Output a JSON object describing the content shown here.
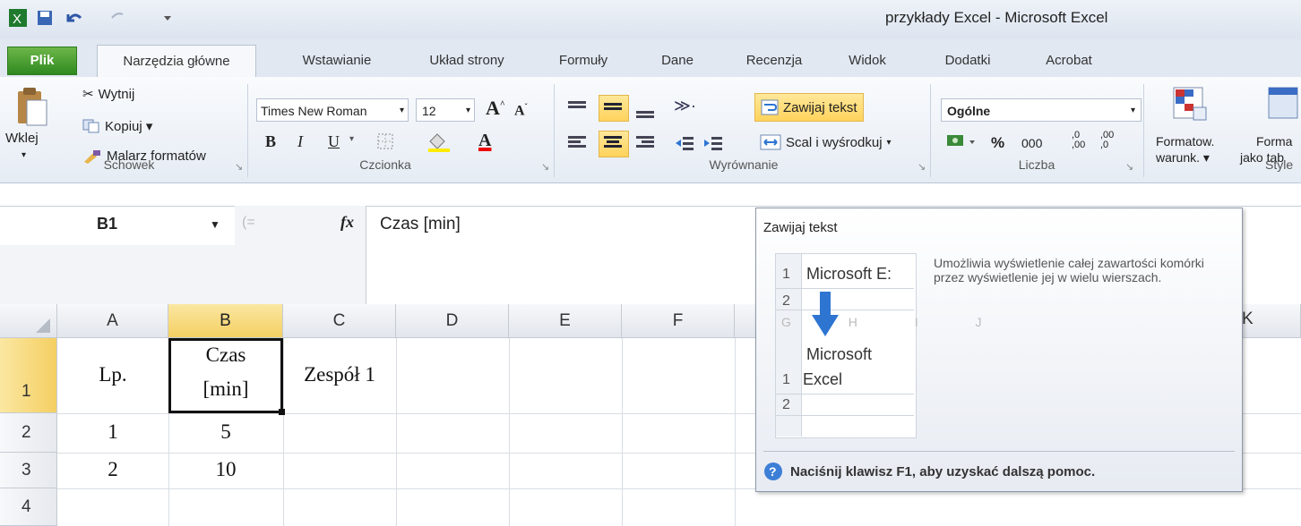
{
  "window": {
    "title": "przykłady Excel - Microsoft Excel"
  },
  "tabs": [
    "Plik",
    "Narzędzia główne",
    "Wstawianie",
    "Układ strony",
    "Formuły",
    "Dane",
    "Recenzja",
    "Widok",
    "Dodatki",
    "Acrobat"
  ],
  "clipboard": {
    "paste": "Wklej",
    "cut": "Wytnij",
    "copy": "Kopiuj ▾",
    "painter": "Malarz formatów",
    "group": "Schowek"
  },
  "font": {
    "name": "Times New Roman",
    "size": "12",
    "group": "Czcionka",
    "bold": "B",
    "italic": "I",
    "underline": "U"
  },
  "alignment": {
    "wrap": "Zawijaj tekst",
    "merge": "Scal i wyśrodkuj",
    "group": "Wyrównanie"
  },
  "number": {
    "format": "Ogólne",
    "percent": "%",
    "thousands": "000",
    "group": "Liczba",
    "inc": ",0 ,00",
    "dec": ",00 ,0"
  },
  "styles": {
    "conditional": "Formatow.",
    "conditional2": "warunk. ▾",
    "table": "Forma",
    "table2": "jako tab",
    "group": "Style"
  },
  "formula_bar": {
    "name_box": "B1",
    "fx": "fx",
    "formula": "Czas [min]"
  },
  "columns": [
    "A",
    "B",
    "C",
    "D",
    "E",
    "F",
    "K"
  ],
  "rows": [
    "1",
    "2",
    "3",
    "4"
  ],
  "cells": {
    "A1": "Lp.",
    "B1_line1": "Czas",
    "B1_line2": "[min]",
    "C1": "Zespół 1",
    "A2": "1",
    "B2": "5",
    "A3": "2",
    "B3": "10"
  },
  "tooltip": {
    "title": "Zawijaj tekst",
    "description": "Umożliwia wyświetlenie całej zawartości komórki przez wyświetlenie jej w wielu wierszach.",
    "illus_before": "Microsoft E:",
    "illus_after1": "Microsoft",
    "illus_after2": "Excel",
    "illus_row1": "1",
    "illus_row2": "2",
    "illus_cols": "G  H  I  J",
    "help": "Naciśnij klawisz F1, aby uzyskać dalszą pomoc."
  },
  "colors": {
    "file_tab": "#2f8a20",
    "selected_header": "#f4cf62",
    "accent": "#2e75d2"
  }
}
